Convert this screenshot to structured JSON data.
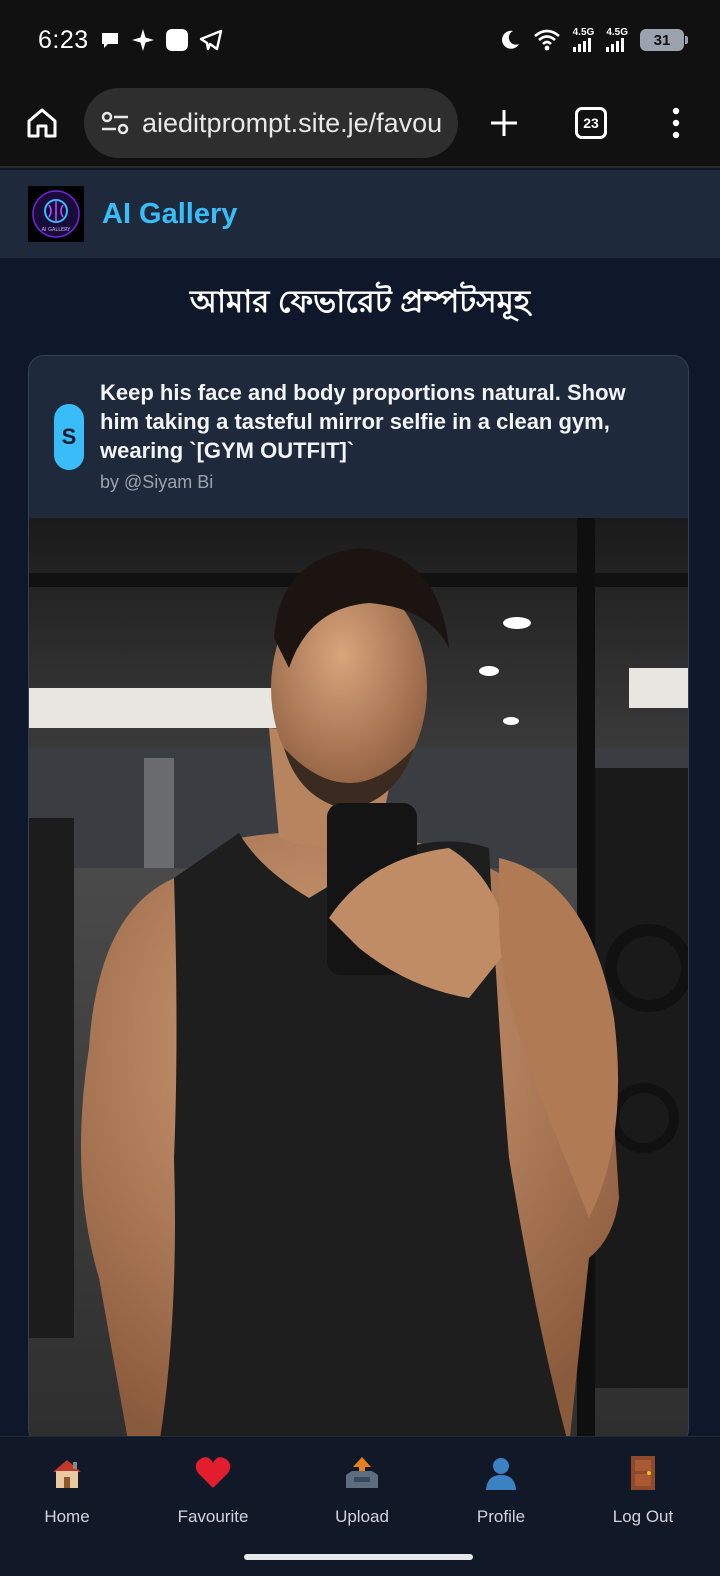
{
  "status_bar": {
    "time": "6:23",
    "network_1": "4.5G",
    "network_2": "4.5G",
    "battery": "31"
  },
  "browser": {
    "url": "aieditprompt.site.je/favou",
    "tab_count": "23"
  },
  "app": {
    "title": "AI Gallery",
    "logo_text": "AI GALLERY"
  },
  "page": {
    "title": "আমার ফেভারেট প্রম্পটসমূহ"
  },
  "card": {
    "avatar_initial": "S",
    "prompt": "Keep his face and body proportions natural. Show him taking a tasteful mirror selfie in a clean gym, wearing `[GYM OUTFIT]`",
    "author": "by @Siyam Bi"
  },
  "bottom_nav": {
    "items": [
      {
        "label": "Home",
        "icon": "house-icon"
      },
      {
        "label": "Favourite",
        "icon": "heart-icon"
      },
      {
        "label": "Upload",
        "icon": "outbox-tray-icon"
      },
      {
        "label": "Profile",
        "icon": "person-icon"
      },
      {
        "label": "Log Out",
        "icon": "door-icon"
      }
    ]
  },
  "colors": {
    "accent": "#38bdf8",
    "page_bg": "#0f172a",
    "card_bg": "#1e293b"
  }
}
